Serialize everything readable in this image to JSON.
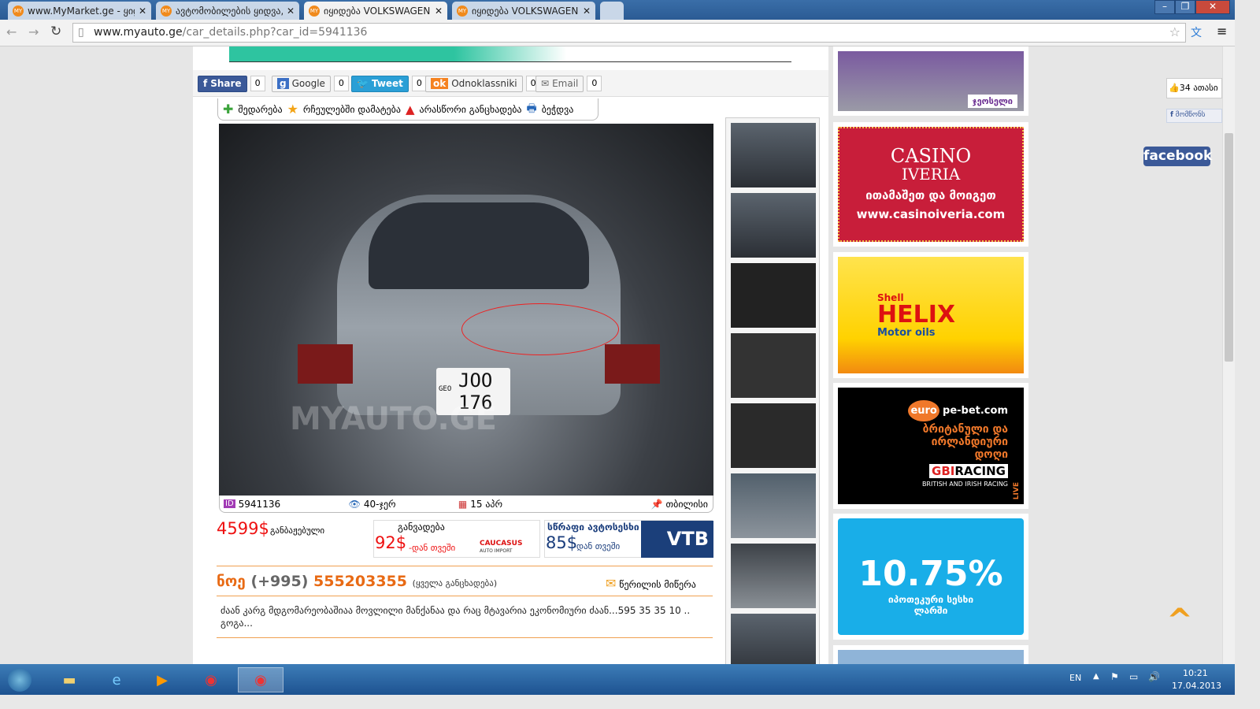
{
  "browser": {
    "tabs": [
      {
        "title": "www.MyMarket.ge - ყიდ"
      },
      {
        "title": "ავტომობილების ყიდვა,"
      },
      {
        "title": "იყიდება VOLKSWAGEN Je"
      },
      {
        "title": "იყიდება VOLKSWAGEN Je"
      }
    ],
    "url_host": "www.myauto.ge",
    "url_path": "/car_details.php?car_id=5941136"
  },
  "share": [
    {
      "label": "Share",
      "count": "0",
      "color": "#3b5998"
    },
    {
      "label": "Google",
      "count": "0",
      "color": "#eeeeee"
    },
    {
      "label": "Tweet",
      "count": "0",
      "color": "#2a9fd6"
    },
    {
      "label": "Odnoklassniki",
      "count": "0",
      "color": "#eeeeee"
    },
    {
      "label": "Email",
      "count": "0",
      "color": "#eeeeee"
    }
  ],
  "actions": [
    "შედარება",
    "რჩეულებში დამატება",
    "არასწორი განცხადება",
    "ბეჭდვა"
  ],
  "photo": {
    "plate_country": "GEO",
    "plate_line1": "JOO",
    "plate_line2": "176",
    "watermark": "MYAUTO.GE"
  },
  "info": {
    "id": "5941136",
    "views": "40-ჯერ",
    "date": "15 აპრ",
    "location": "თბილისი"
  },
  "price": {
    "value": "4599$",
    "note": "განბაჟებული"
  },
  "installment": {
    "title": "განვადება",
    "value": "92$",
    "suffix": "-დან თვეში",
    "brand": "CAUCASUS",
    "brand_sub": "AUTO IMPORT"
  },
  "loan": {
    "title": "სწრაფი ავტოსესხი",
    "value": "85$",
    "suffix": "-დან თვეში",
    "brand": "VTB"
  },
  "contact": {
    "name": "ნოე",
    "code": "(+995)",
    "phone": "555203355",
    "all_ads": "(ყველა განცხადება)",
    "message": "წერილის მიწერა"
  },
  "description": "ძაან კარგ მდგომარეობაშიაა მოვლილი მანქანაა და რაც მტავარია ეკონომიური ძაან...595 35 35 10 .. გოგა...",
  "ads": {
    "casino_title1": "CASINO",
    "casino_title2": "IVERIA",
    "casino_slogan": "ითამაშეთ და მოიგეთ",
    "casino_url": "www.casinoiveria.com",
    "geocell": "ჯეოსელი",
    "shell_brand": "Shell",
    "shell_product": "HELIX",
    "shell_sub": "Motor oils",
    "bet_logo1": "euro",
    "bet_logo2": "pe-bet.com",
    "bet_text": "ბრიტანული და ირლანდიური დოღი",
    "bet_brand1": "GBI",
    "bet_brand2": "RACING",
    "bet_sub": "BRITISH AND IRISH RACING",
    "bet_live": "LIVE",
    "bank_rate": "10.75%",
    "bank_text": "იპოთეკური სესხი ლარში"
  },
  "social": {
    "likes": "34 ათასი",
    "recommend": "მომწონს",
    "facebook": "facebook"
  },
  "taskbar": {
    "lang": "EN",
    "time": "10:21",
    "date": "17.04.2013"
  }
}
